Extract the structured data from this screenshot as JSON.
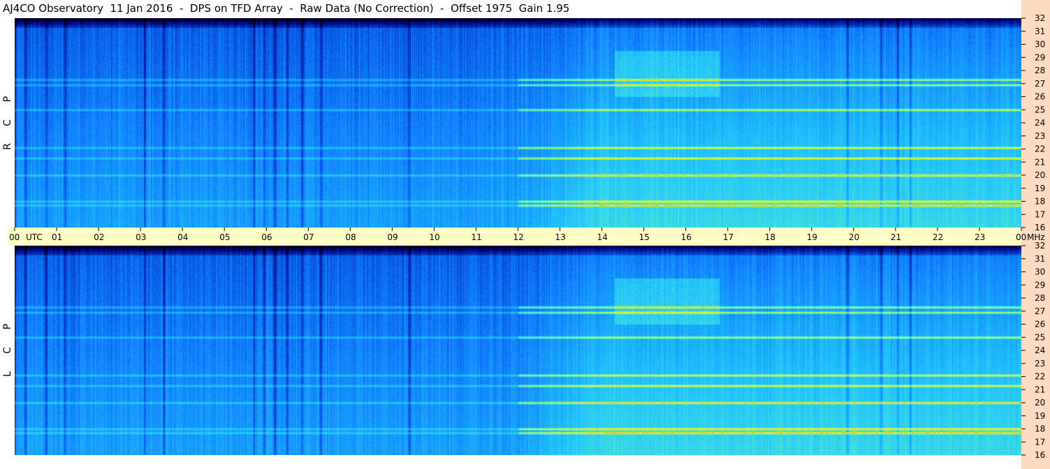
{
  "title": "AJ4CO Observatory  11 Jan 2016  -  DPS on TFD Array  -  Raw Data (No Correction)  -  Offset 1975  Gain 1.95",
  "colors": {
    "title_bg": "#ffffff",
    "freq_axis_bg": "#fcdcc0",
    "time_axis_bg": "#ffffc6",
    "colormap": [
      "#000010",
      "#000060",
      "#0030c0",
      "#1080ff",
      "#20c0ff",
      "#40e0e0",
      "#c0ff40",
      "#ffe020",
      "#ff2000"
    ]
  },
  "chart_data": {
    "type": "heatmap",
    "title": "AJ4CO Observatory  11 Jan 2016  -  DPS on TFD Array  -  Raw Data (No Correction)  -  Offset 1975  Gain 1.95",
    "xlabel": "UTC",
    "ylabel": "MHz",
    "x_ticks": [
      "00",
      "01",
      "02",
      "03",
      "04",
      "05",
      "06",
      "07",
      "08",
      "09",
      "10",
      "11",
      "12",
      "13",
      "14",
      "15",
      "16",
      "17",
      "18",
      "19",
      "20",
      "21",
      "22",
      "23",
      "00"
    ],
    "x_range_hours": [
      0,
      24
    ],
    "y_ticks": [
      "32",
      "31",
      "30",
      "29",
      "28",
      "27",
      "26",
      "25",
      "24",
      "23",
      "22",
      "21",
      "20",
      "19",
      "18",
      "17",
      "16"
    ],
    "y_range_mhz": [
      16,
      32
    ],
    "panels": [
      {
        "name": "RCP",
        "label_letters": [
          "R",
          "C",
          "P"
        ]
      },
      {
        "name": "LCP",
        "label_letters": [
          "L",
          "C",
          "P"
        ]
      }
    ],
    "dark_onset_columns_hours": [
      0.0,
      0.25,
      0.75,
      1.2,
      3.1,
      3.55,
      5.7,
      5.95,
      6.2,
      6.5,
      6.85,
      7.3,
      9.4,
      19.85,
      20.65,
      21.05,
      21.35
    ],
    "bright_band_mhz": [
      17.7,
      18.0,
      20.0,
      21.3,
      22.1,
      25.0,
      26.9,
      27.3
    ],
    "active_period_hours": [
      12.0,
      24.0
    ],
    "storm_region": {
      "hours": [
        14.3,
        16.8
      ],
      "mhz": [
        26.0,
        29.5
      ]
    }
  },
  "axis": {
    "utc_label": "UTC",
    "mhz_label": "MHz"
  }
}
